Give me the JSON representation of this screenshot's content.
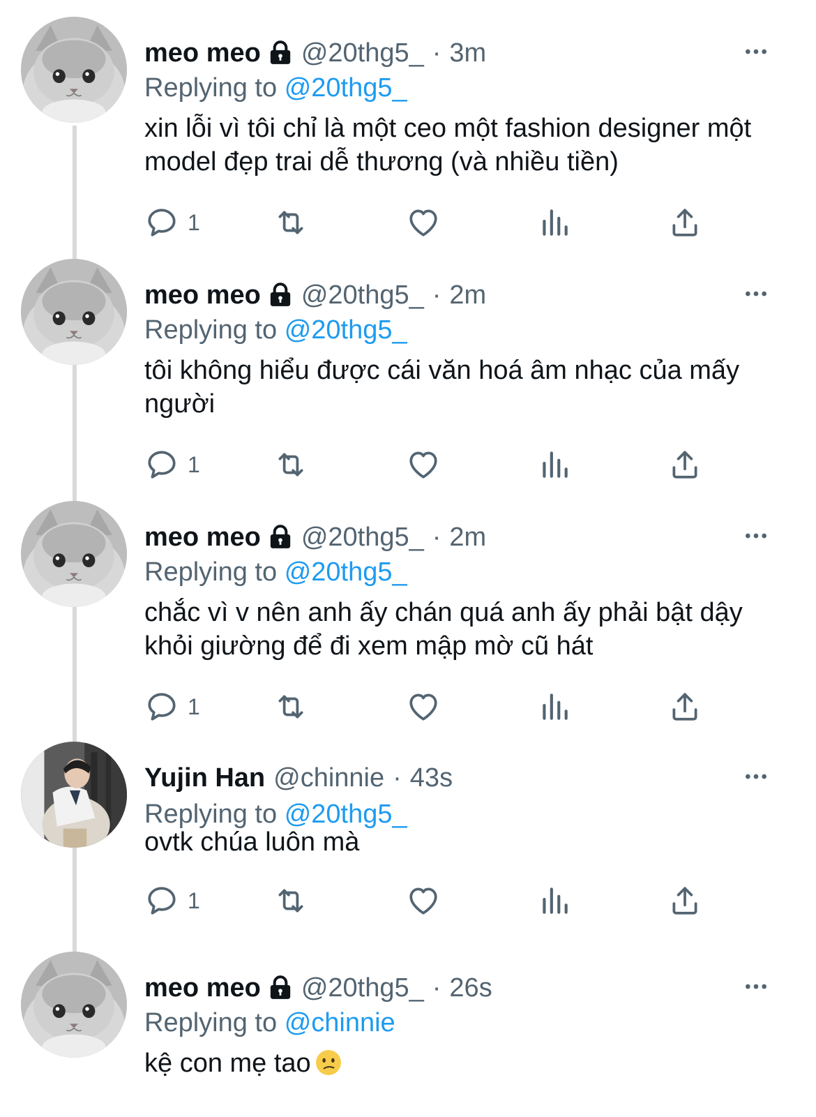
{
  "colors": {
    "text": "#0f1419",
    "muted": "#536471",
    "accent": "#1d9bf0",
    "thread": "#d9d9d9"
  },
  "tweets": [
    {
      "name": "meo meo",
      "handle": "@20thg5_",
      "separator": "·",
      "time": "3m",
      "replying_prefix": "Replying to",
      "replying_to": "@20thg5_",
      "text": "xin lỗi vì tôi chỉ là một ceo một fashion designer một model đẹp trai dễ thương (và nhiều tiền)",
      "reply_count": "1",
      "avatar": "cat-avatar",
      "locked": true
    },
    {
      "name": "meo meo",
      "handle": "@20thg5_",
      "separator": "·",
      "time": "2m",
      "replying_prefix": "Replying to",
      "replying_to": "@20thg5_",
      "text": "tôi không hiểu được cái văn hoá âm nhạc của mấy người",
      "reply_count": "1",
      "avatar": "cat-avatar",
      "locked": true
    },
    {
      "name": "meo meo",
      "handle": "@20thg5_",
      "separator": "·",
      "time": "2m",
      "replying_prefix": "Replying to",
      "replying_to": "@20thg5_",
      "text": "chắc vì v nên anh ấy chán quá anh ấy phải bật dậy khỏi giường để đi xem mập mờ cũ hát",
      "reply_count": "1",
      "avatar": "cat-avatar",
      "locked": true
    },
    {
      "name": "Yujin Han",
      "handle": "@chinnie",
      "separator": "·",
      "time": "43s",
      "replying_prefix": "Replying to",
      "replying_to": "@20thg5_",
      "text": "ovtk chúa luôn mà",
      "reply_count": "1",
      "avatar": "person-avatar",
      "locked": false
    },
    {
      "name": "meo meo",
      "handle": "@20thg5_",
      "separator": "·",
      "time": "26s",
      "replying_prefix": "Replying to",
      "replying_to": "@chinnie",
      "text": "kệ con mẹ tao",
      "emoji": "confused-face-emoji",
      "avatar": "cat-avatar",
      "locked": true
    }
  ]
}
